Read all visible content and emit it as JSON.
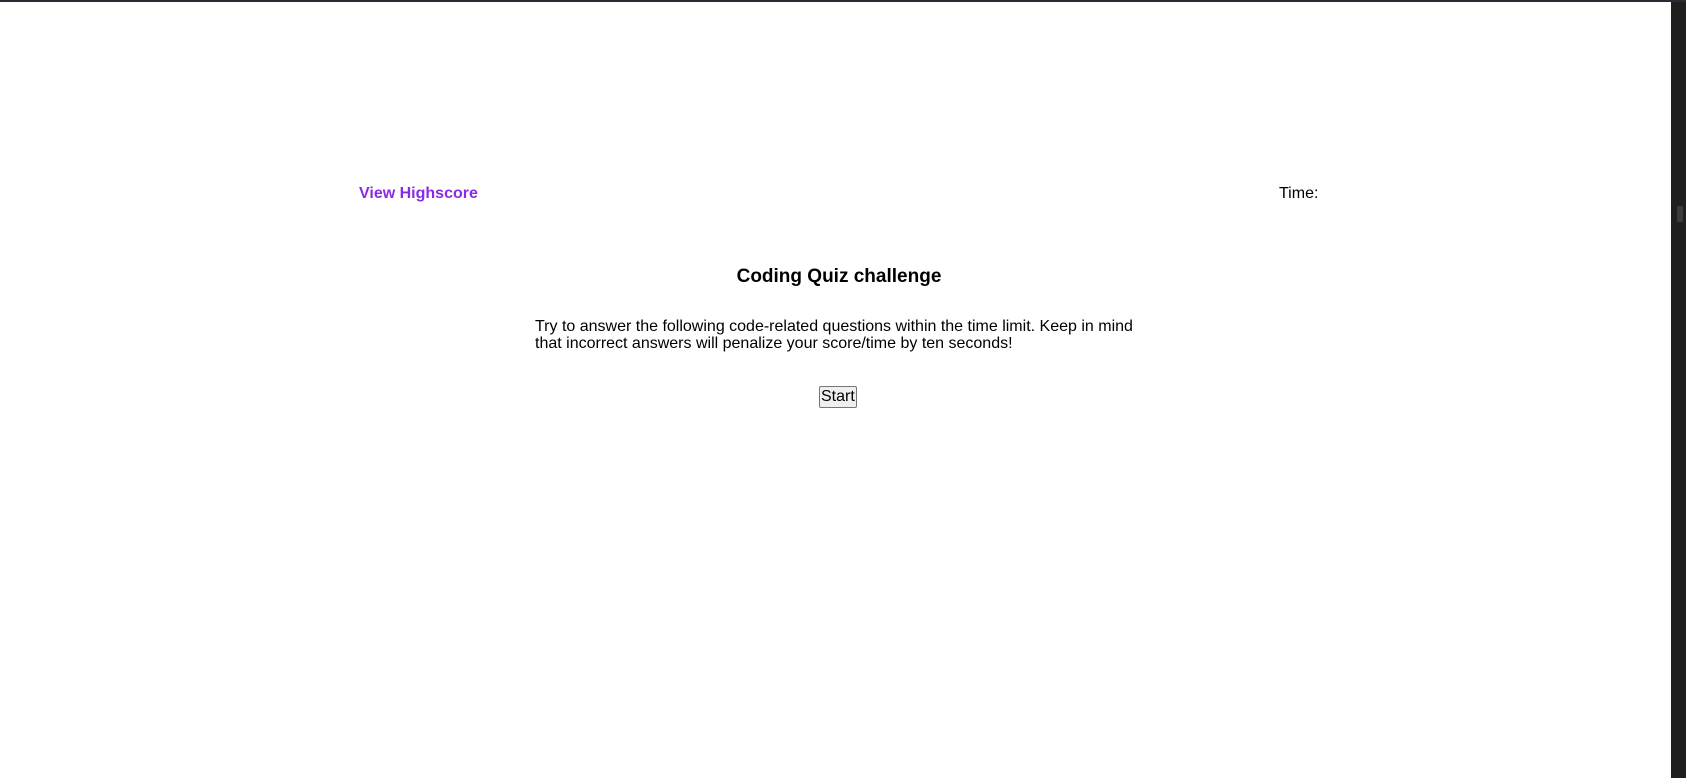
{
  "header": {
    "highscore_link": "View Highscore",
    "timer_label": "Time:"
  },
  "main": {
    "title": "Coding Quiz challenge",
    "description": "Try to answer the following code-related questions within the time limit. Keep in mind that incorrect answers will penalize your score/time by ten seconds!",
    "start_label": "Start"
  },
  "colors": {
    "link": "#8a2be2",
    "background": "#ffffff",
    "text": "#000000"
  }
}
